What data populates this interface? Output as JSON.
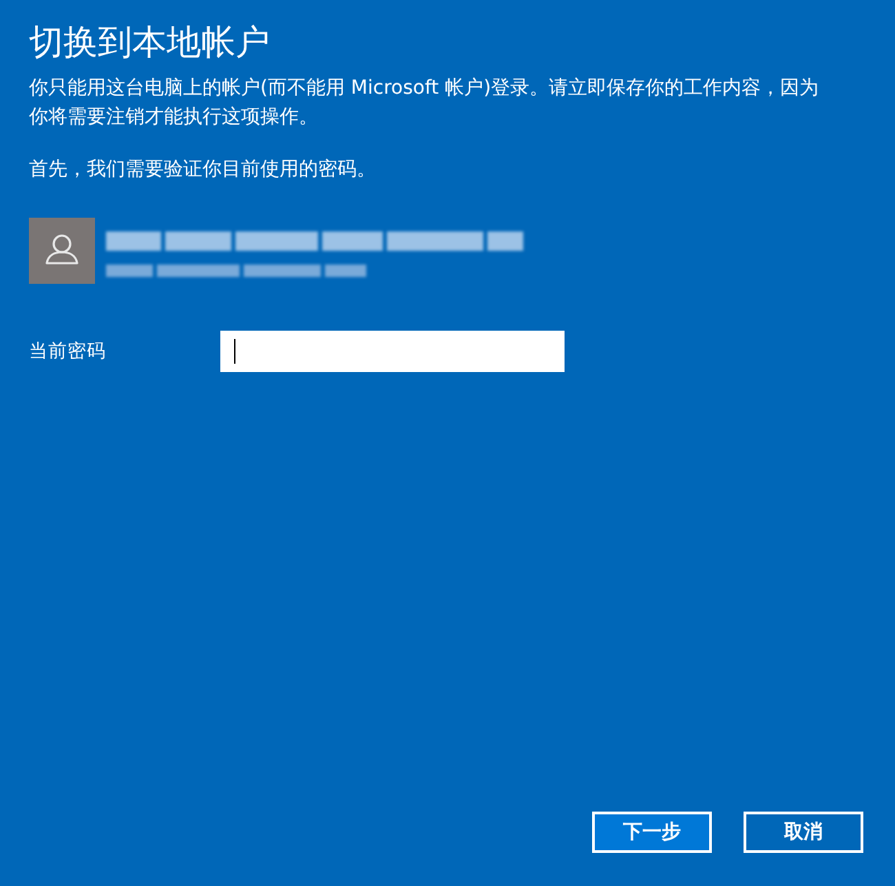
{
  "window": {
    "title": "切换到本地帐户"
  },
  "intro": "你只能用这台电脑上的帐户(而不能用 Microsoft 帐户)登录。请立即保存你的工作内容，因为你将需要注销才能执行这项操作。",
  "prompt": "首先，我们需要验证你目前使用的密码。",
  "password_field": {
    "label": "当前密码",
    "focused": true
  },
  "buttons": [
    {
      "label": "下一步",
      "kind": "primary"
    },
    {
      "label": "取消",
      "kind": "secondary"
    }
  ]
}
